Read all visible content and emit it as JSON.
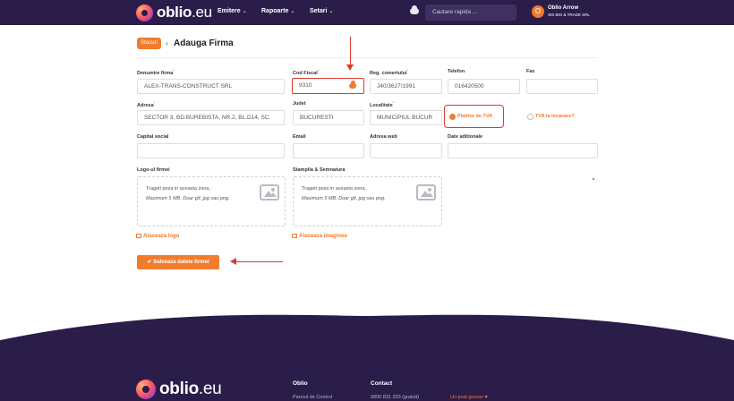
{
  "brand": {
    "name": "oblio",
    "tld": ".eu"
  },
  "nav": {
    "items": [
      {
        "label": "Emitere"
      },
      {
        "label": "Rapoarte"
      },
      {
        "label": "Setari"
      }
    ],
    "search_placeholder": "Cautare rapida ...",
    "user": {
      "initial": "O",
      "name": "Oblio Arrow",
      "company": "SIS BIO & TRADE SRL"
    }
  },
  "breadcrumb": {
    "parent": "Stocuri",
    "separator": "›",
    "title": "Adauga Firma"
  },
  "form": {
    "denumire": {
      "label": "Denumire firma",
      "value": "ALEX-TRANS-CONSTRUCT SRL"
    },
    "cod_fiscal": {
      "label": "Cod Fiscal",
      "value": "9310"
    },
    "reg_com": {
      "label": "Reg. comertului",
      "value": "J40/3627/1991"
    },
    "telefon": {
      "label": "Telefon",
      "value": "016420500"
    },
    "fax": {
      "label": "Fax",
      "value": ""
    },
    "adresa": {
      "label": "Adresa",
      "value": "SECTOR 3, BD.BUREBISTA, NR.2, BL.D14, SC."
    },
    "judet": {
      "label": "Judet",
      "value": "BUCURESTI"
    },
    "localitate": {
      "label": "Localitate",
      "value": "MUNICIPIUL BUCUR"
    },
    "platitor_tva": {
      "label": "Platitor de TVA",
      "checked": true
    },
    "tva_incasare": {
      "label": "TVA la incasare?",
      "checked": false
    },
    "capital": {
      "label": "Capital social",
      "value": ""
    },
    "email": {
      "label": "Email",
      "value": ""
    },
    "web": {
      "label": "Adresa web",
      "value": ""
    },
    "date_aditionale": {
      "label": "Date aditionale",
      "value": ""
    },
    "logo": {
      "label": "Logo-ul firmei",
      "hint1": "Trageti poza in aceasta zona..",
      "hint2": "Maximum 5 MB. Doar gif, jpg sau png.",
      "attach": "Ataseaza logo"
    },
    "stampila": {
      "label": "Stampila & Semnatura",
      "hint1": "Trageti poza in aceasta zona..",
      "hint2": "Maximum 5 MB. Doar gif, jpg sau png.",
      "attach": "Ataseaza imaginea"
    },
    "save_label": "Salveaza datele firmei"
  },
  "footer": {
    "col1_title": "Oblio",
    "col1_item": "Panoul de Control",
    "col2_title": "Contact",
    "col2_item": "0800 831 333 (gratuit)",
    "love": "Un post grozav ♥"
  },
  "colors": {
    "accent": "#f07c2e",
    "nav_bg": "#2b1d4a",
    "annotation": "#e03a30"
  }
}
